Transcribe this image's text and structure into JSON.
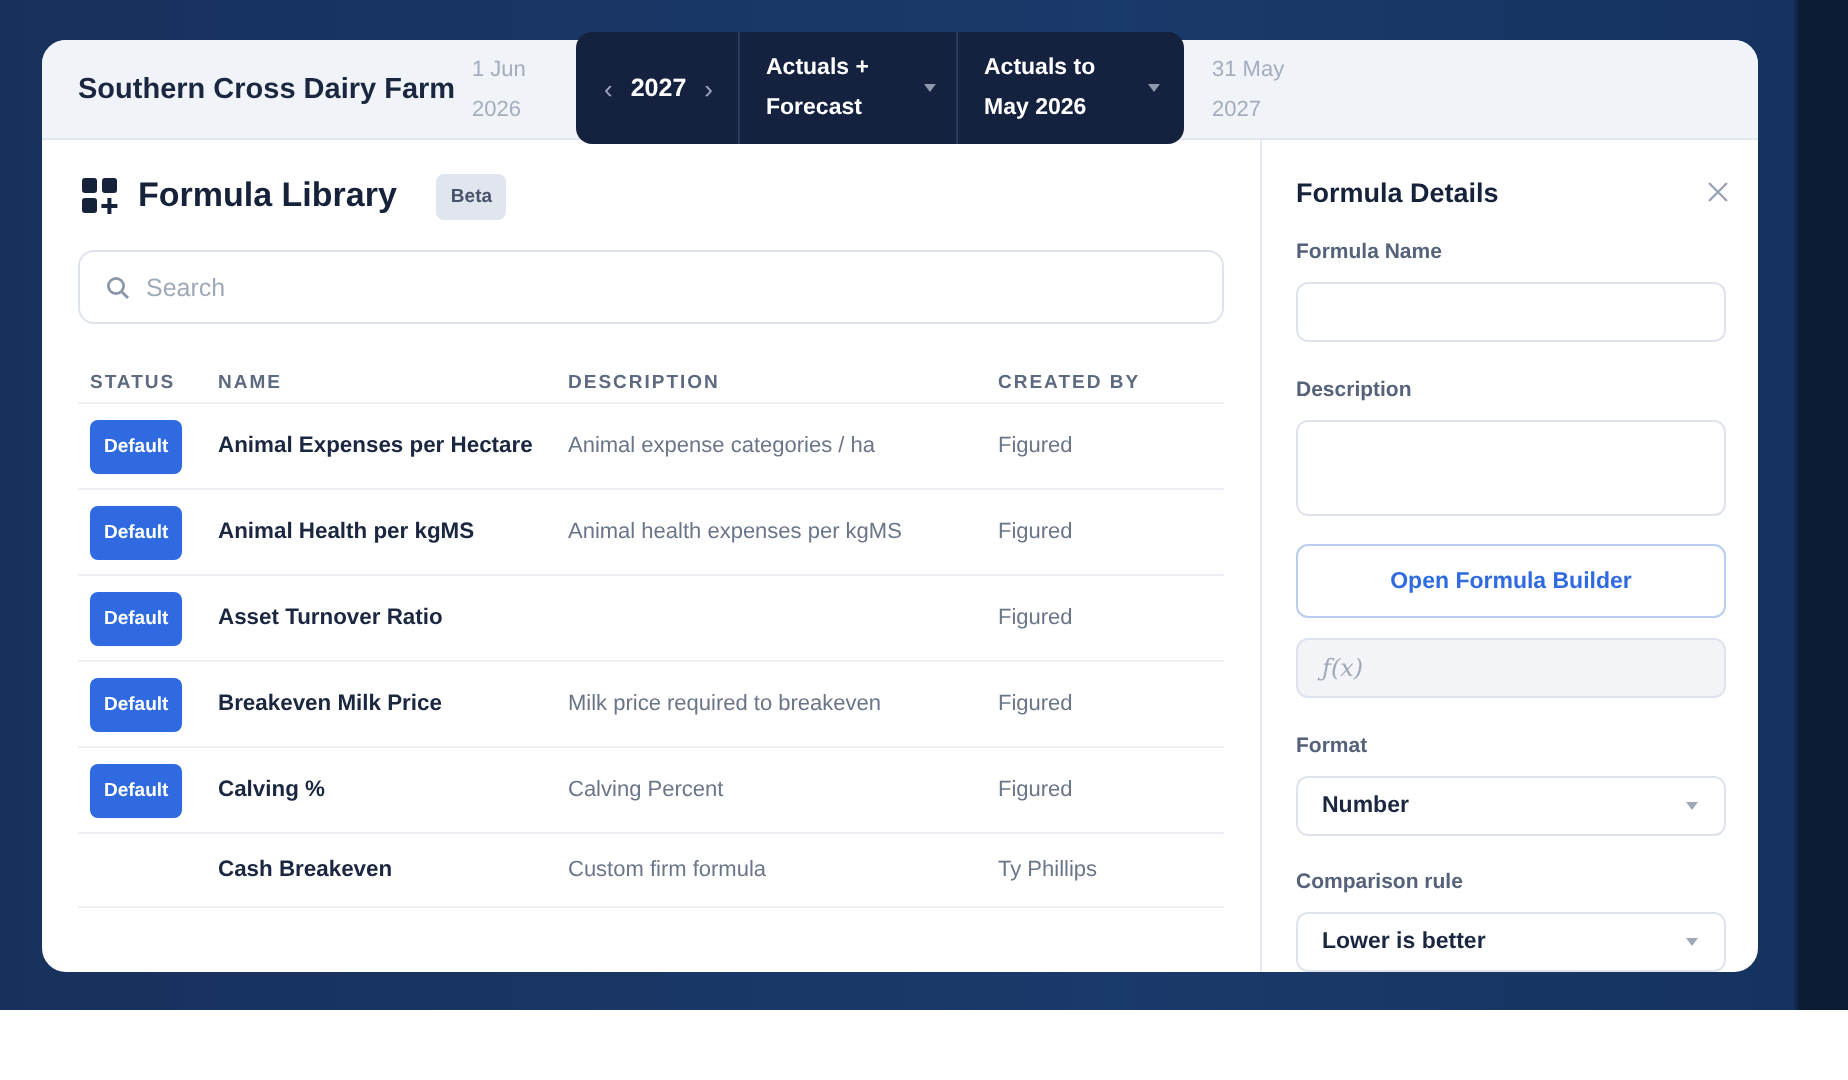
{
  "header": {
    "farm_name": "Southern Cross Dairy Farm",
    "start_date": "1 Jun 2026",
    "end_date": "31 May 2027",
    "year_nav": {
      "prev": "‹",
      "year": "2027",
      "next": "›"
    },
    "dropdowns": [
      {
        "label": "Actuals + Forecast"
      },
      {
        "label": "Actuals to May 2026"
      }
    ]
  },
  "library": {
    "title": "Formula Library",
    "badge": "Beta",
    "search": {
      "placeholder": "Search"
    },
    "columns": [
      "STATUS",
      "NAME",
      "DESCRIPTION",
      "CREATED BY"
    ],
    "rows": [
      {
        "status": "Default",
        "name": "Animal Expenses per Hectare",
        "description": "Animal expense categories / ha",
        "created_by": "Figured"
      },
      {
        "status": "Default",
        "name": "Animal Health per kgMS",
        "description": "Animal health expenses per kgMS",
        "created_by": "Figured"
      },
      {
        "status": "Default",
        "name": "Asset Turnover Ratio",
        "created_by": "Figured"
      },
      {
        "status": "Default",
        "name": "Breakeven Milk Price",
        "description": "Milk price required to breakeven",
        "created_by": "Figured"
      },
      {
        "status": "Default",
        "name": "Calving %",
        "description": "Calving Percent",
        "created_by": "Figured"
      },
      {
        "name": "Cash Breakeven",
        "description": "Custom firm formula",
        "created_by": "Ty Phillips"
      }
    ]
  },
  "details": {
    "title": "Formula Details",
    "fields": [
      {
        "kind": "text",
        "label": "Formula Name"
      },
      {
        "kind": "textarea",
        "label": "Description"
      },
      {
        "kind": "button",
        "label": "Open Formula Builder"
      },
      {
        "kind": "formula",
        "placeholder": "ƒ(x)"
      },
      {
        "kind": "select",
        "label": "Format",
        "value": "Number"
      },
      {
        "kind": "select",
        "label": "Comparison rule",
        "value": "Lower is better"
      }
    ]
  }
}
